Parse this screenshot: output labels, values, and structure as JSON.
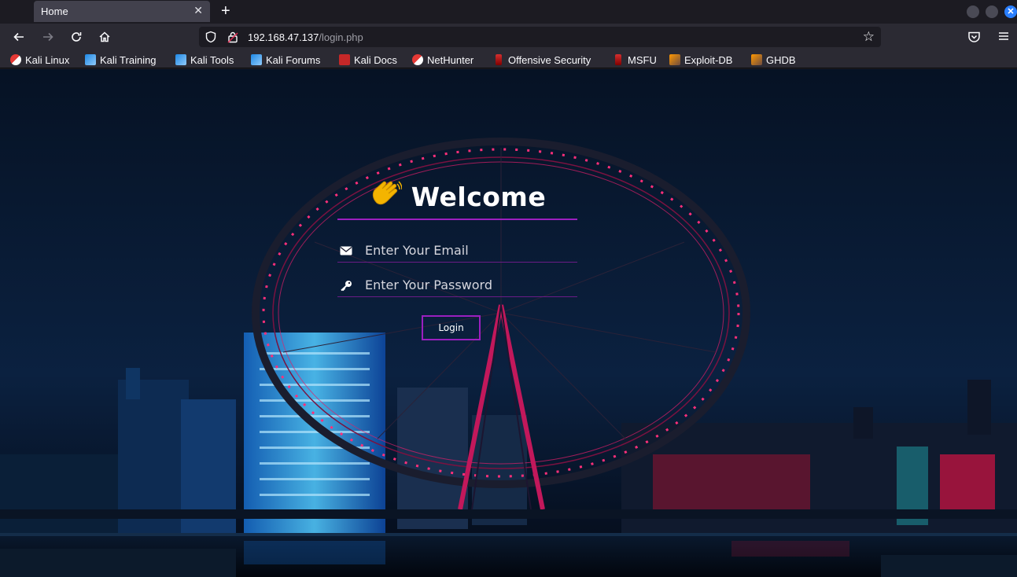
{
  "browser": {
    "tab": {
      "title": "Home",
      "close_glyph": "✕"
    },
    "new_tab_glyph": "+",
    "window_close_glyph": "✕",
    "url": {
      "host": "192.168.47.137",
      "path": "/login.php"
    },
    "bookmarks": [
      {
        "label": "Kali Linux",
        "icon": "kali-dragon-icon"
      },
      {
        "label": "Kali Training",
        "icon": "kali-training-icon"
      },
      {
        "label": "Kali Tools",
        "icon": "kali-tools-icon"
      },
      {
        "label": "Kali Forums",
        "icon": "kali-forums-icon"
      },
      {
        "label": "Kali Docs",
        "icon": "kali-docs-icon"
      },
      {
        "label": "NetHunter",
        "icon": "nethunter-icon"
      },
      {
        "label": "Offensive Security",
        "icon": "offsec-icon"
      },
      {
        "label": "MSFU",
        "icon": "msfu-icon"
      },
      {
        "label": "Exploit-DB",
        "icon": "exploit-db-icon"
      },
      {
        "label": "GHDB",
        "icon": "ghdb-icon"
      }
    ]
  },
  "page": {
    "heading": "Welcome",
    "heading_icon": "waving-hand-icon",
    "email_placeholder": "Enter Your Email",
    "password_placeholder": "Enter Your Password",
    "login_label": "Login"
  },
  "colors": {
    "accent": "#9b1fbf",
    "wheel_lights": "#ff2f7a",
    "building_glow": "#3fa9ff"
  }
}
